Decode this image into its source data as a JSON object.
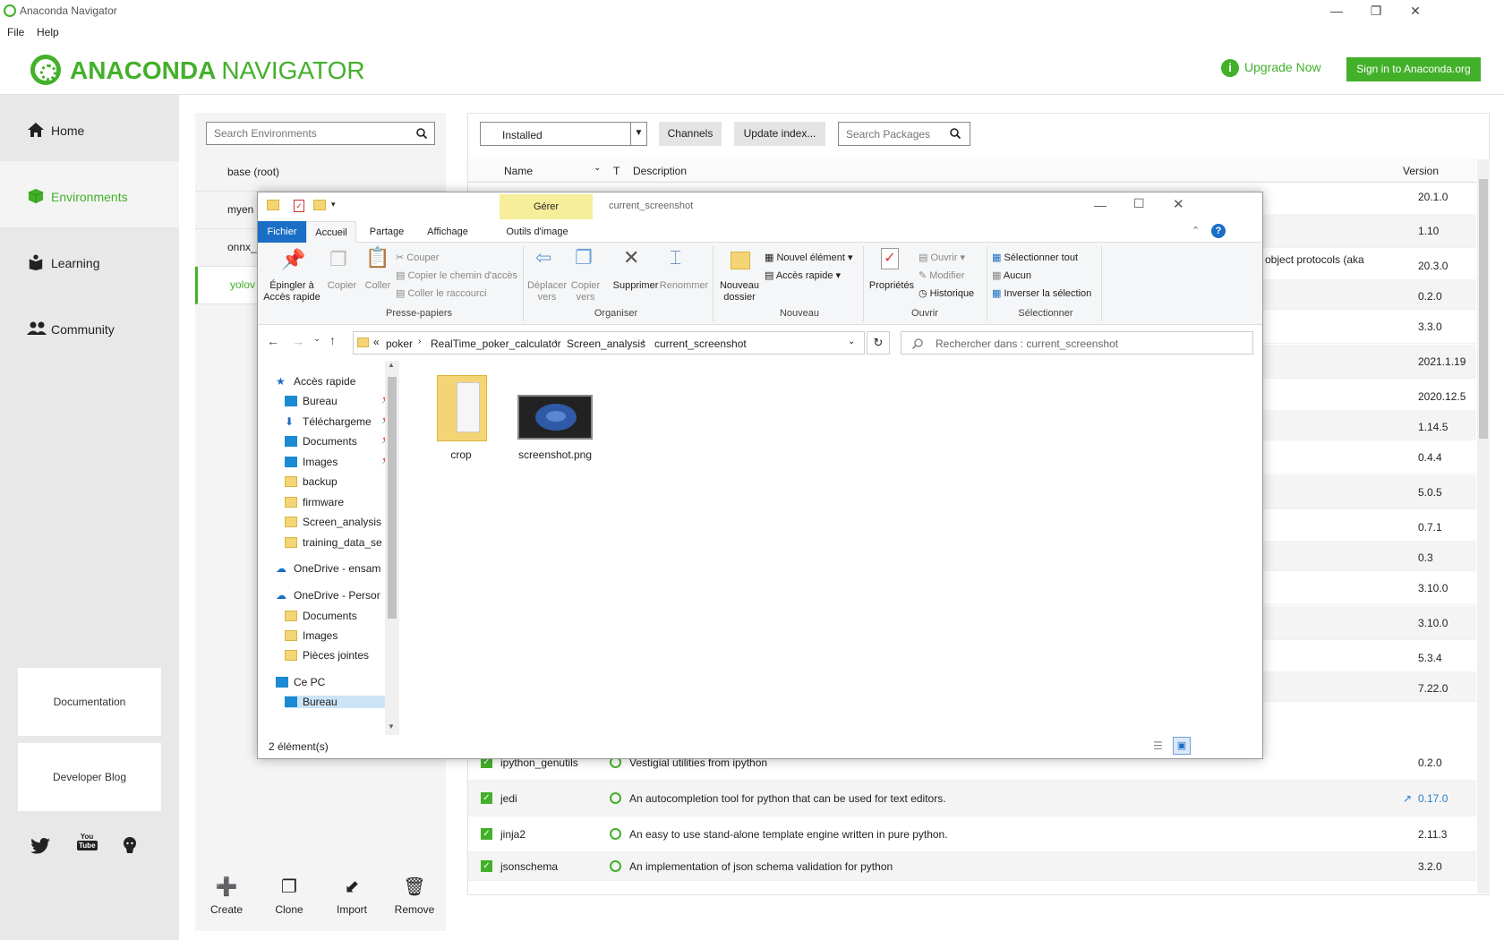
{
  "window": {
    "title": "Anaconda Navigator",
    "minimize": "—",
    "restore": "❐",
    "close": "✕"
  },
  "menu": {
    "file": "File",
    "help": "Help"
  },
  "header": {
    "brand_bold": "ANACONDA",
    "brand_light": "NAVIGATOR",
    "upgrade": "Upgrade Now",
    "signin": "Sign in to Anaconda.org",
    "accent": "#43b02a"
  },
  "nav": {
    "items": [
      {
        "label": "Home",
        "icon": "home-icon"
      },
      {
        "label": "Environments",
        "icon": "cube-icon"
      },
      {
        "label": "Learning",
        "icon": "book-icon"
      },
      {
        "label": "Community",
        "icon": "people-icon"
      }
    ],
    "cards": [
      "Documentation",
      "Developer Blog"
    ],
    "social": [
      "twitter-icon",
      "youtube-icon",
      "github-icon"
    ]
  },
  "env": {
    "search_placeholder": "Search Environments",
    "items": [
      "base (root)",
      "myen",
      "onnx_",
      "yolov"
    ],
    "buttons": [
      {
        "label": "Create",
        "icon": "plus-icon"
      },
      {
        "label": "Clone",
        "icon": "clone-icon"
      },
      {
        "label": "Import",
        "icon": "import-icon"
      },
      {
        "label": "Remove",
        "icon": "trash-icon"
      }
    ]
  },
  "packages": {
    "filter": "Installed",
    "channels": "Channels",
    "update_index": "Update index...",
    "search_placeholder": "Search Packages",
    "columns": {
      "name": "Name",
      "t": "T",
      "description": "Description",
      "version": "Version"
    },
    "partial_text": "object protocols (aka",
    "versions": [
      "20.1.0",
      "1.10",
      "20.3.0",
      "0.2.0",
      "3.3.0",
      "2021.1.19",
      "2020.12.5",
      "1.14.5",
      "0.4.4",
      "5.0.5",
      "0.7.1",
      "0.3",
      "3.10.0",
      "3.10.0",
      "5.3.4",
      "7.22.0"
    ],
    "rows": [
      {
        "name": "ipython_genutils",
        "description": "Vestigial utilities from ipython",
        "version": "0.2.0",
        "update": false
      },
      {
        "name": "jedi",
        "description": "An autocompletion tool for python that can be used for text editors.",
        "version": "0.17.0",
        "update": true
      },
      {
        "name": "jinja2",
        "description": "An easy to use stand-alone template engine written in pure python.",
        "version": "2.11.3",
        "update": false
      },
      {
        "name": "jsonschema",
        "description": "An implementation of json schema validation for python",
        "version": "3.2.0",
        "update": false
      }
    ]
  },
  "explorer": {
    "title": "current_screenshot",
    "gerer": "Gérer",
    "tabs": [
      "Fichier",
      "Accueil",
      "Partage",
      "Affichage",
      "Outils d'image"
    ],
    "ribbon": {
      "pin": "Épingler à\nAccès rapide",
      "copy": "Copier",
      "paste": "Coller",
      "cut": "Couper",
      "copy_path": "Copier le chemin d'accès",
      "paste_shortcut": "Coller le raccourci",
      "group_clipboard": "Presse-papiers",
      "move_to": "Déplacer\nvers",
      "copy_to": "Copier\nvers",
      "delete": "Supprimer",
      "rename": "Renommer",
      "group_organize": "Organiser",
      "new_folder": "Nouveau\ndossier",
      "new_item": "Nouvel élément",
      "easy_access": "Accès rapide",
      "group_new": "Nouveau",
      "properties": "Propriétés",
      "open": "Ouvrir",
      "edit": "Modifier",
      "history": "Historique",
      "group_open": "Ouvrir",
      "select_all": "Sélectionner tout",
      "select_none": "Aucun",
      "invert": "Inverser la sélection",
      "group_select": "Sélectionner"
    },
    "breadcrumb": [
      "poker",
      "RealTime_poker_calculator",
      "Screen_analysis",
      "current_screenshot"
    ],
    "search_placeholder": "Rechercher dans : current_screenshot",
    "tree": [
      {
        "label": "Accès rapide",
        "icon": "star-icon",
        "indent": 0
      },
      {
        "label": "Bureau",
        "icon": "desktop-icon",
        "indent": 1,
        "pinned": true
      },
      {
        "label": "Téléchargeme",
        "icon": "download-icon",
        "indent": 1,
        "pinned": true
      },
      {
        "label": "Documents",
        "icon": "documents-icon",
        "indent": 1,
        "pinned": true
      },
      {
        "label": "Images",
        "icon": "images-icon",
        "indent": 1,
        "pinned": true
      },
      {
        "label": "backup",
        "icon": "folder-icon",
        "indent": 1
      },
      {
        "label": "firmware",
        "icon": "folder-icon",
        "indent": 1
      },
      {
        "label": "Screen_analysis",
        "icon": "folder-icon",
        "indent": 1
      },
      {
        "label": "training_data_se",
        "icon": "folder-icon",
        "indent": 1
      },
      {
        "label": "OneDrive - ensam",
        "icon": "cloud-icon",
        "indent": 0
      },
      {
        "label": "OneDrive - Persor",
        "icon": "cloud-icon",
        "indent": 0
      },
      {
        "label": "Documents",
        "icon": "folder-icon",
        "indent": 1
      },
      {
        "label": "Images",
        "icon": "folder-icon",
        "indent": 1
      },
      {
        "label": "Pièces jointes",
        "icon": "folder-icon",
        "indent": 1
      },
      {
        "label": "Ce PC",
        "icon": "pc-icon",
        "indent": 0
      },
      {
        "label": "Bureau",
        "icon": "desktop-icon",
        "indent": 1,
        "selected": true
      }
    ],
    "files": [
      {
        "name": "crop",
        "type": "folder"
      },
      {
        "name": "screenshot.png",
        "type": "image"
      }
    ],
    "status": "2 élément(s)"
  }
}
